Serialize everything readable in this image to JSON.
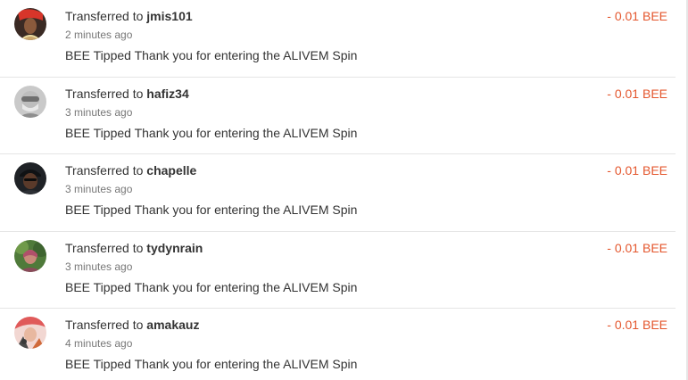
{
  "colors": {
    "amount_negative": "#e4572e",
    "divider": "#e5e5e5",
    "text_primary": "#333333",
    "text_muted": "#777777"
  },
  "transfers": [
    {
      "prefix": "Transferred to",
      "username": "jmis101",
      "time": "2 minutes ago",
      "memo": "BEE Tipped Thank you for entering the ALIVEM Spin",
      "amount": "- 0.01 BEE",
      "avatar": "avatar-jmis101"
    },
    {
      "prefix": "Transferred to",
      "username": "hafiz34",
      "time": "3 minutes ago",
      "memo": "BEE Tipped Thank you for entering the ALIVEM Spin",
      "amount": "- 0.01 BEE",
      "avatar": "avatar-hafiz34"
    },
    {
      "prefix": "Transferred to",
      "username": "chapelle",
      "time": "3 minutes ago",
      "memo": "BEE Tipped Thank you for entering the ALIVEM Spin",
      "amount": "- 0.01 BEE",
      "avatar": "avatar-chapelle"
    },
    {
      "prefix": "Transferred to",
      "username": "tydynrain",
      "time": "3 minutes ago",
      "memo": "BEE Tipped Thank you for entering the ALIVEM Spin",
      "amount": "- 0.01 BEE",
      "avatar": "avatar-tydynrain"
    },
    {
      "prefix": "Transferred to",
      "username": "amakauz",
      "time": "4 minutes ago",
      "memo": "BEE Tipped Thank you for entering the ALIVEM Spin",
      "amount": "- 0.01 BEE",
      "avatar": "avatar-amakauz"
    }
  ]
}
